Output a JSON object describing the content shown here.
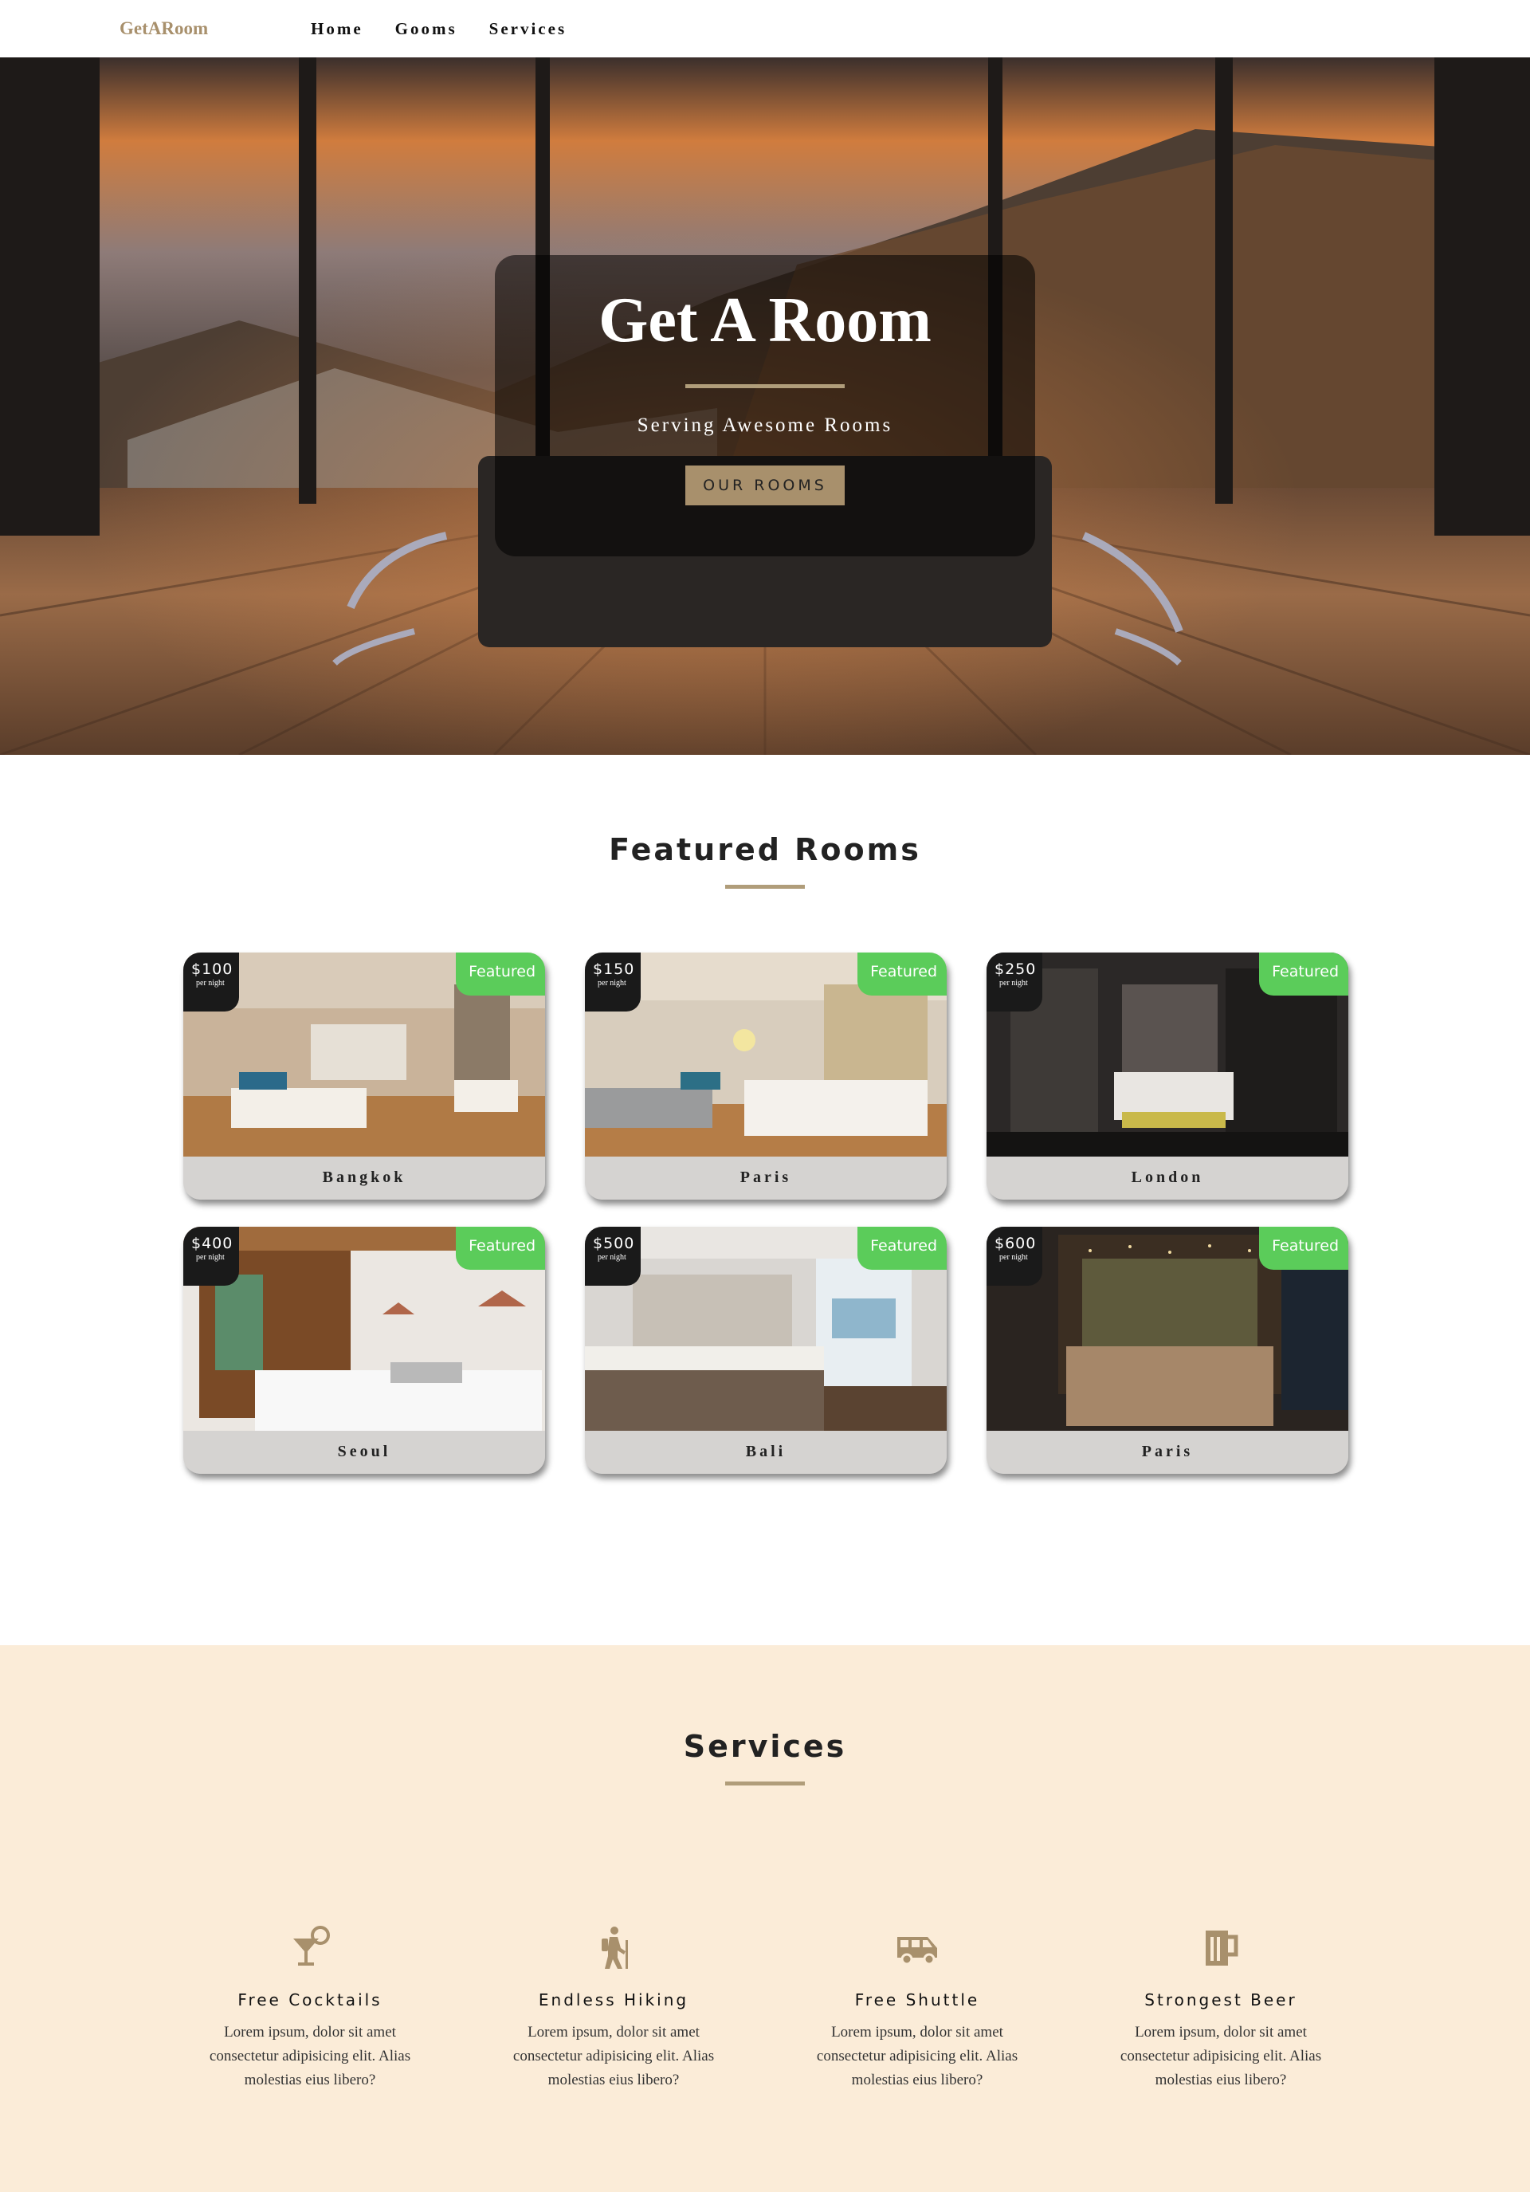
{
  "navbar": {
    "logo": "GetARoom",
    "links": [
      "Home",
      "Gooms",
      "Services"
    ]
  },
  "hero": {
    "title": "Get A Room",
    "subtitle": "Serving Awesome Rooms",
    "button": "OUR ROOMS"
  },
  "featured": {
    "title": "Featured Rooms",
    "badge": "Featured",
    "per_night": "per night",
    "rooms": [
      {
        "price": "$100",
        "city": "Bangkok"
      },
      {
        "price": "$150",
        "city": "Paris"
      },
      {
        "price": "$250",
        "city": "London"
      },
      {
        "price": "$400",
        "city": "Seoul"
      },
      {
        "price": "$500",
        "city": "Bali"
      },
      {
        "price": "$600",
        "city": "Paris"
      }
    ]
  },
  "services": {
    "title": "Services",
    "items": [
      {
        "icon": "cocktail-icon",
        "title": "Free Cocktails",
        "desc": "Lorem ipsum, dolor sit amet consectetur adipisicing elit. Alias molestias eius libero?"
      },
      {
        "icon": "hiking-icon",
        "title": "Endless Hiking",
        "desc": "Lorem ipsum, dolor sit amet consectetur adipisicing elit. Alias molestias eius libero?"
      },
      {
        "icon": "shuttle-van-icon",
        "title": "Free Shuttle",
        "desc": "Lorem ipsum, dolor sit amet consectetur adipisicing elit. Alias molestias eius libero?"
      },
      {
        "icon": "beer-icon",
        "title": "Strongest Beer",
        "desc": "Lorem ipsum, dolor sit amet consectetur adipisicing elit. Alias molestias eius libero?"
      }
    ]
  },
  "colors": {
    "accent": "#a8906c",
    "featured_green": "#5bcc5a",
    "services_bg": "#fbecd8"
  }
}
